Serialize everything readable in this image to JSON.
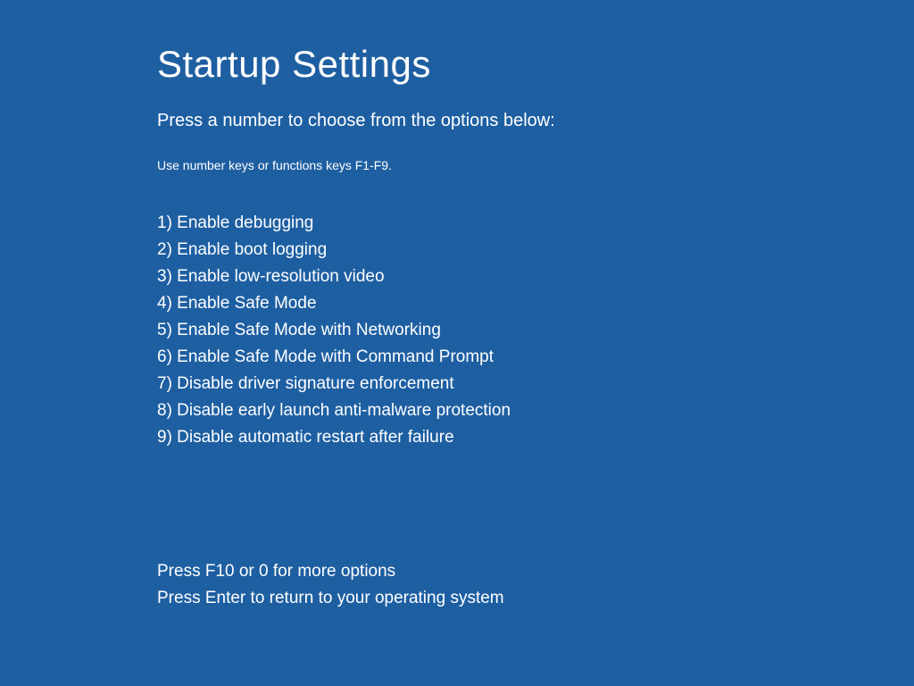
{
  "title": "Startup Settings",
  "subtitle": "Press a number to choose from the options below:",
  "hint": "Use number keys or functions keys F1-F9.",
  "options": [
    "1) Enable debugging",
    "2) Enable boot logging",
    "3) Enable low-resolution video",
    "4) Enable Safe Mode",
    "5) Enable Safe Mode with Networking",
    "6) Enable Safe Mode with Command Prompt",
    "7) Disable driver signature enforcement",
    "8) Disable early launch anti-malware protection",
    "9) Disable automatic restart after failure"
  ],
  "footer": {
    "more_options": "Press F10 or 0 for more options",
    "return": "Press Enter to return to your operating system"
  }
}
